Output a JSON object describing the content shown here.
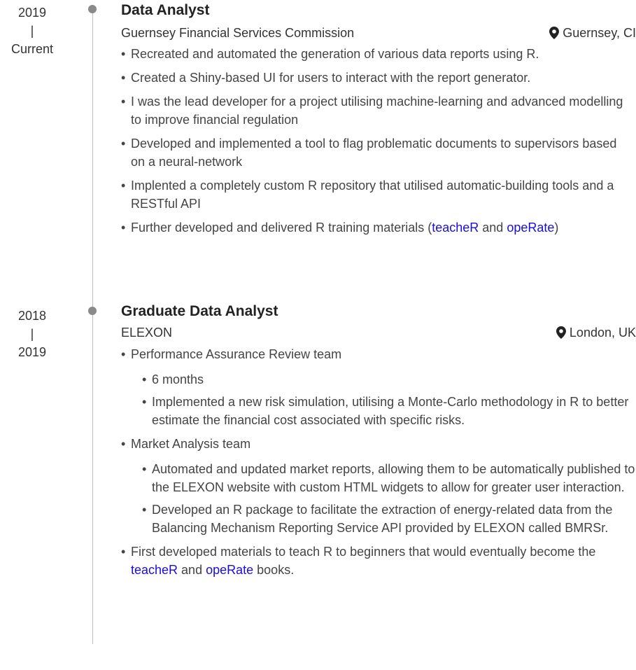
{
  "entries": [
    {
      "date_start": "2019",
      "date_sep": "|",
      "date_end": "Current",
      "title": "Data Analyst",
      "org": "Guernsey Financial Services Commission",
      "location": "Guernsey, CI",
      "bullets": [
        "Recreated and automated the generation of various data reports using R.",
        "Created a Shiny-based UI for users to interact with the report generator.",
        "I was the lead developer for a project utilising machine-learning and advanced modelling to improve financial regulation",
        "Developed and implemented a tool to flag problematic documents to supervisors based on a neural-network",
        "Implented a completely custom R repository that utilised automatic-building tools and a RESTful API"
      ],
      "last_bullet": {
        "text_before": "Further developed and delivered R training materials (",
        "link1": "teacheR",
        "text_mid": " and ",
        "link2": "opeRate",
        "text_after": ")"
      }
    },
    {
      "date_start": "2018",
      "date_sep": "|",
      "date_end": "2019",
      "title": "Graduate Data Analyst",
      "org": "ELEXON",
      "location": "London, UK",
      "team1": {
        "label": "Performance Assurance Review team",
        "items": [
          "6 months",
          "Implemented a new risk simulation, utilising a Monte-Carlo methodology in R to better estimate the financial cost associated with specific risks."
        ]
      },
      "team2": {
        "label": "Market Analysis team",
        "items": [
          "Automated and updated market reports, allowing them to be automatically published to the ELEXON website with custom HTML widgets to allow for greater user interaction.",
          "Developed an R package to facilitate the extraction of energy-related data from the Balancing Mechanism Reporting Service API provided by ELEXON called BMRSr."
        ]
      },
      "last_bullet": {
        "text_before": "First developed materials to teach R to beginners that would eventually become the ",
        "link1": "teacheR",
        "text_mid": " and ",
        "link2": "opeRate",
        "text_after": " books."
      }
    }
  ],
  "icons": {
    "location": "map-marker-icon",
    "timeline_dot": "timeline-dot-icon"
  },
  "colors": {
    "link": "#1a0dd8",
    "dot": "#8a8a8a",
    "line": "#bdbdbd"
  }
}
